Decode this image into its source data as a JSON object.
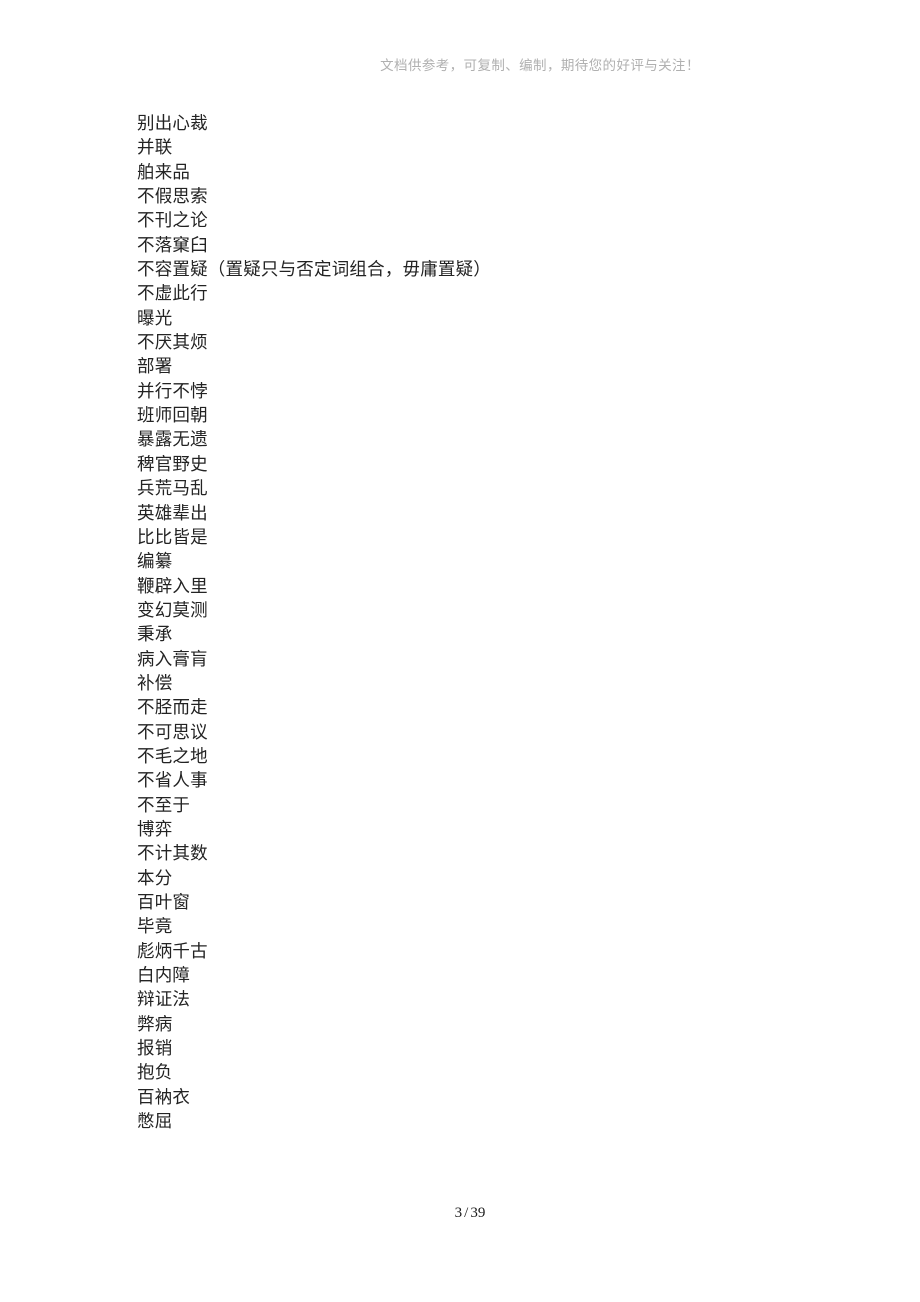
{
  "header": {
    "watermark": "文档供参考，可复制、编制，期待您的好评与关注！"
  },
  "footer": {
    "current_page": "3",
    "separator": "/",
    "total_pages": "39",
    "combined": "3 / 39"
  },
  "document": {
    "lines": [
      {
        "text": "别出心裁"
      },
      {
        "text": "并联"
      },
      {
        "text": "舶来品"
      },
      {
        "text": "不假思索"
      },
      {
        "text": "不刊之论"
      },
      {
        "text": "不落窠臼"
      },
      {
        "text": "不容置疑（置疑只与否定词组合，毋庸置疑）"
      },
      {
        "text": "不虚此行"
      },
      {
        "text": "曝光"
      },
      {
        "text": "不厌其烦"
      },
      {
        "text": "部署"
      },
      {
        "text": "并行不悖"
      },
      {
        "text": "班师回朝"
      },
      {
        "text": "暴露无遗"
      },
      {
        "text": "稗官野史"
      },
      {
        "text": "兵荒马乱"
      },
      {
        "text": "英雄辈出"
      },
      {
        "text": "比比皆是"
      },
      {
        "text": "编纂"
      },
      {
        "text": "鞭辟入里"
      },
      {
        "text": "变幻莫测"
      },
      {
        "text": "秉承"
      },
      {
        "text": "病入膏肓"
      },
      {
        "text": "补偿"
      },
      {
        "text": "不胫而走"
      },
      {
        "text": "不可思议"
      },
      {
        "text": "不毛之地"
      },
      {
        "text": "不省人事"
      },
      {
        "text": "不至于"
      },
      {
        "text": "博弈"
      },
      {
        "text": "不计其数"
      },
      {
        "text": "本分"
      },
      {
        "text": "百叶窗"
      },
      {
        "text": "毕竟"
      },
      {
        "text": "彪炳千古"
      },
      {
        "text": "白内障"
      },
      {
        "text": "辩证法"
      },
      {
        "text": "弊病"
      },
      {
        "text": "报销"
      },
      {
        "text": "抱负"
      },
      {
        "text": "百衲衣"
      },
      {
        "text": "憋屈"
      }
    ]
  },
  "colors": {
    "page_background": "#ffffff",
    "body_text": "#232323",
    "header_watermark": "#b0b0b0",
    "footer_text": "#1a1a1a"
  }
}
